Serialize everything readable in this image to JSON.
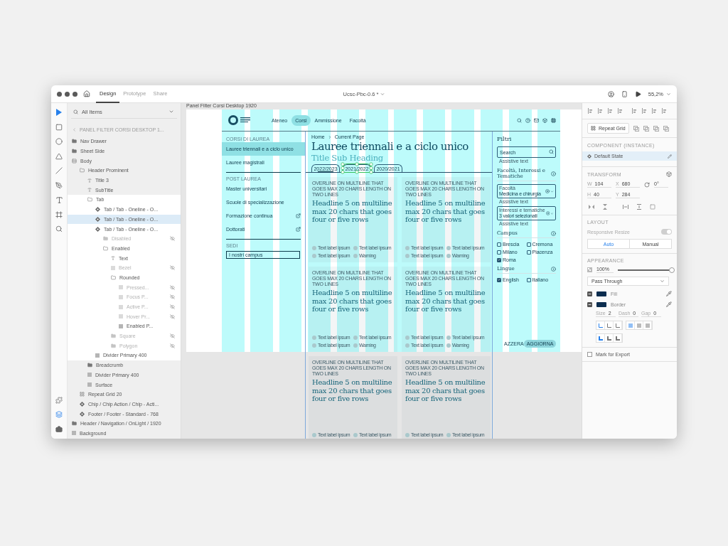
{
  "window": {
    "tabs": [
      {
        "label": "Design",
        "selected": true
      },
      {
        "label": "Prototype",
        "selected": false
      },
      {
        "label": "Share",
        "selected": false
      }
    ],
    "title": "Ucsc-Pbc-0.6 *",
    "zoom": "55,2%"
  },
  "layers": {
    "filter": "All Items",
    "context": "PANEL FILTER CORSI DESKTOP 1...",
    "items": [
      {
        "name": "Nav Drawer",
        "kind": "folder",
        "selected": false,
        "hidden": false
      },
      {
        "name": "Sheet Side",
        "kind": "folder",
        "selected": false,
        "hidden": false
      },
      {
        "name": "Body",
        "kind": "stack",
        "selected": false,
        "hidden": false,
        "children": [
          {
            "name": "Header Prominent",
            "kind": "group",
            "selected": false,
            "hidden": false,
            "children": [
              {
                "name": "Title 3",
                "kind": "text",
                "selected": false,
                "hidden": false
              },
              {
                "name": "SubTitle",
                "kind": "text",
                "selected": false,
                "hidden": false
              },
              {
                "name": "Tab",
                "kind": "group",
                "selected": false,
                "hidden": false,
                "in_focus": true,
                "children": [
                  {
                    "name": "Tab / Tab - Oneline - O...",
                    "kind": "component",
                    "selected": false,
                    "hidden": false
                  },
                  {
                    "name": "Tab / Tab - Oneline - O...",
                    "kind": "component",
                    "selected": true,
                    "hidden": false
                  },
                  {
                    "name": "Tab / Tab - Oneline - O...",
                    "kind": "component",
                    "selected": false,
                    "hidden": false,
                    "children": [
                      {
                        "name": "Disabled",
                        "kind": "folder",
                        "selected": false,
                        "hidden": true
                      },
                      {
                        "name": "Enabled",
                        "kind": "group",
                        "selected": false,
                        "hidden": false,
                        "children": [
                          {
                            "name": "Text",
                            "kind": "text",
                            "selected": false,
                            "hidden": false
                          },
                          {
                            "name": "Bezel",
                            "kind": "rect",
                            "selected": false,
                            "hidden": true
                          },
                          {
                            "name": "Rounded",
                            "kind": "group",
                            "selected": false,
                            "hidden": false,
                            "children": [
                              {
                                "name": "Pressed...",
                                "kind": "rect",
                                "selected": false,
                                "hidden": true
                              },
                              {
                                "name": "Focus P...",
                                "kind": "rect",
                                "selected": false,
                                "hidden": true
                              },
                              {
                                "name": "Active P...",
                                "kind": "rect",
                                "selected": false,
                                "hidden": true
                              },
                              {
                                "name": "Hover Pr...",
                                "kind": "rect",
                                "selected": false,
                                "hidden": true
                              },
                              {
                                "name": "Enabled P...",
                                "kind": "rect",
                                "selected": false,
                                "hidden": false
                              }
                            ]
                          },
                          {
                            "name": "Square",
                            "kind": "folder",
                            "selected": false,
                            "hidden": true
                          },
                          {
                            "name": "Polygon",
                            "kind": "folder",
                            "selected": false,
                            "hidden": true
                          }
                        ]
                      }
                    ]
                  },
                  {
                    "name": "Divider Primary 400",
                    "kind": "rect",
                    "selected": false,
                    "hidden": false
                  }
                ]
              },
              {
                "name": "Breadcrumb",
                "kind": "folder",
                "selected": false,
                "hidden": false
              },
              {
                "name": "Divider Primary 400",
                "kind": "rect",
                "selected": false,
                "hidden": false
              },
              {
                "name": "Surface",
                "kind": "rect",
                "selected": false,
                "hidden": false
              }
            ]
          },
          {
            "name": "Repeat Grid 20",
            "kind": "grid",
            "selected": false,
            "hidden": false
          },
          {
            "name": "Chip / Chip Action / Chip - Acti...",
            "kind": "component",
            "selected": false,
            "hidden": false
          },
          {
            "name": "Footer / Footer - Standard - 768",
            "kind": "component",
            "selected": false,
            "hidden": false
          }
        ]
      },
      {
        "name": "Header / Navigation / OnLight / 1920",
        "kind": "folder",
        "selected": false,
        "hidden": false
      },
      {
        "name": "Background",
        "kind": "rect",
        "selected": false,
        "hidden": false
      }
    ]
  },
  "artboard": {
    "title": "Panel Filter Corsi Desktop 1920",
    "nav": [
      {
        "label": "Ateneo",
        "selected": false
      },
      {
        "label": "Corsi",
        "selected": true
      },
      {
        "label": "Ammissione",
        "selected": false
      },
      {
        "label": "Facoltà",
        "selected": false
      }
    ],
    "sidebar": [
      {
        "heading": "CORSI DI LAUREA",
        "items": [
          {
            "label": "Lauree triennali e a ciclo unico",
            "selected": true,
            "external": false
          },
          {
            "label": "Lauree magistrali",
            "selected": false,
            "external": false
          }
        ]
      },
      {
        "heading": "POST LAUREA",
        "items": [
          {
            "label": "Master universitari",
            "selected": false,
            "external": false
          },
          {
            "label": "Scuole di specializzazione",
            "selected": false,
            "external": false
          },
          {
            "label": "Formazione continua",
            "selected": false,
            "external": true
          },
          {
            "label": "Dottorati",
            "selected": false,
            "external": true
          }
        ]
      },
      {
        "heading": "SEDI",
        "items": [
          {
            "label": "I nostri campus",
            "selected": false,
            "external": false,
            "kind": "outlined"
          }
        ]
      }
    ],
    "main": {
      "breadcrumb": [
        "Home",
        "Current Page"
      ],
      "title": "Lauree triennali e a ciclo unico",
      "subtitle": "Title Sub Heading",
      "tabs": [
        {
          "label": "2022/2023",
          "selected": true,
          "editing": false
        },
        {
          "label": "2021/2022",
          "selected": false,
          "editing": true
        },
        {
          "label": "2020/2021",
          "selected": false,
          "editing": false
        }
      ],
      "cards": [
        {
          "overline": "OVERLINE ON MULTILINE THAT GOES MAX 20 CHARS LENGTH ON TWO LINES",
          "headline": "Headline 5 on multiline max 20 chars that goes four or five rows",
          "chips": [
            "Text label ipsum",
            "Text label ipsum",
            "Text label ipsum"
          ],
          "status": "Warning"
        },
        {
          "overline": "OVERLINE ON MULTILINE THAT GOES MAX 20 CHARS LENGTH ON TWO LINES",
          "headline": "Headline 5 on multiline max 20 chars that goes four or five rows",
          "chips": [
            "Text label ipsum",
            "Text label ipsum",
            "Text label ipsum"
          ],
          "status": "Warning"
        },
        {
          "overline": "OVERLINE ON MULTILINE THAT GOES MAX 20 CHARS LENGTH ON TWO LINES",
          "headline": "Headline 5 on multiline max 20 chars that goes four or five rows",
          "chips": [
            "Text label ipsum",
            "Text label ipsum",
            "Text label ipsum"
          ],
          "status": "Warning"
        },
        {
          "overline": "OVERLINE ON MULTILINE THAT GOES MAX 20 CHARS LENGTH ON TWO LINES",
          "headline": "Headline 5 on multiline max 20 chars that goes four or five rows",
          "chips": [
            "Text label ipsum",
            "Text label ipsum",
            "Text label ipsum"
          ],
          "status": "Warning"
        },
        {
          "overline": "OVERLINE ON MULTILINE THAT GOES MAX 20 CHARS LENGTH ON TWO LINES",
          "headline": "Headline 5 on multiline max 20 chars that goes four or five rows",
          "chips": [
            "Text label ipsum",
            "Text label ipsum"
          ]
        },
        {
          "overline": "OVERLINE ON MULTILINE THAT GOES MAX 20 CHARS LENGTH ON TWO LINES",
          "headline": "Headline 5 on multiline max 20 chars that goes four or five rows",
          "chips": [
            "Text label ipsum",
            "Text label ipsum"
          ]
        }
      ]
    },
    "filters": {
      "title": "Filtri",
      "search": {
        "placeholder": "Search",
        "helper": "Assistive text"
      },
      "groups": [
        {
          "title": "Facoltà, Interessi e Tematiche",
          "kind": "dropdowns",
          "fields": [
            {
              "label": "Facoltà",
              "value": "Medicina e chirurgia",
              "helper": "Assistive text"
            },
            {
              "label": "Interessi e tematiche",
              "value": "3 valori selezionati",
              "helper": "Assistive text"
            }
          ]
        },
        {
          "title": "Campus",
          "kind": "checkboxes",
          "options": [
            {
              "label": "Brescia",
              "checked": false
            },
            {
              "label": "Cremona",
              "checked": false
            },
            {
              "label": "Milano",
              "checked": false
            },
            {
              "label": "Piacenza",
              "checked": false
            },
            {
              "label": "Roma",
              "checked": true
            }
          ]
        },
        {
          "title": "Lingue",
          "kind": "checkboxes",
          "options": [
            {
              "label": "English",
              "checked": true
            },
            {
              "label": "Italiano",
              "checked": false
            }
          ]
        }
      ],
      "reset": "AZZERA",
      "apply": "AGGIORNA"
    }
  },
  "inspector": {
    "repeat_grid": "Repeat Grid",
    "component": {
      "heading": "COMPONENT (INSTANCE)",
      "state": "Default State"
    },
    "transform": {
      "heading": "TRANSFORM",
      "fields": [
        {
          "label": "W",
          "value": "104"
        },
        {
          "label": "X",
          "value": "680"
        },
        {
          "label": "H",
          "value": "40"
        },
        {
          "label": "Y",
          "value": "284"
        }
      ],
      "rotation": "0°"
    },
    "layout": {
      "heading": "LAYOUT",
      "responsive": {
        "label": "Responsive Resize",
        "on": true,
        "disabled": true
      },
      "modes": [
        {
          "label": "Auto",
          "selected": true
        },
        {
          "label": "Manual",
          "selected": false
        }
      ]
    },
    "appearance": {
      "heading": "APPEARANCE",
      "opacity": {
        "reading": "100%",
        "level": 1
      },
      "blend": "Pass Through",
      "paints": [
        {
          "label": "Fill",
          "color": "#0b2d4f",
          "enabled": true
        },
        {
          "label": "Border",
          "color": "#0b2d4f",
          "enabled": true
        }
      ],
      "stroke": [
        {
          "label": "Size",
          "value": "2"
        },
        {
          "label": "Dash",
          "value": "0"
        },
        {
          "label": "Gap",
          "value": "0"
        }
      ],
      "border_position": [
        {
          "selected": true
        },
        {
          "selected": false
        },
        {
          "selected": false
        }
      ],
      "border_join": [
        {
          "selected": true
        },
        {
          "selected": false
        },
        {
          "selected": false
        }
      ],
      "corners": [
        {
          "selected": true
        },
        {
          "selected": false
        },
        {
          "selected": false
        }
      ]
    },
    "export": {
      "label": "Mark for Export",
      "checked": false
    }
  }
}
